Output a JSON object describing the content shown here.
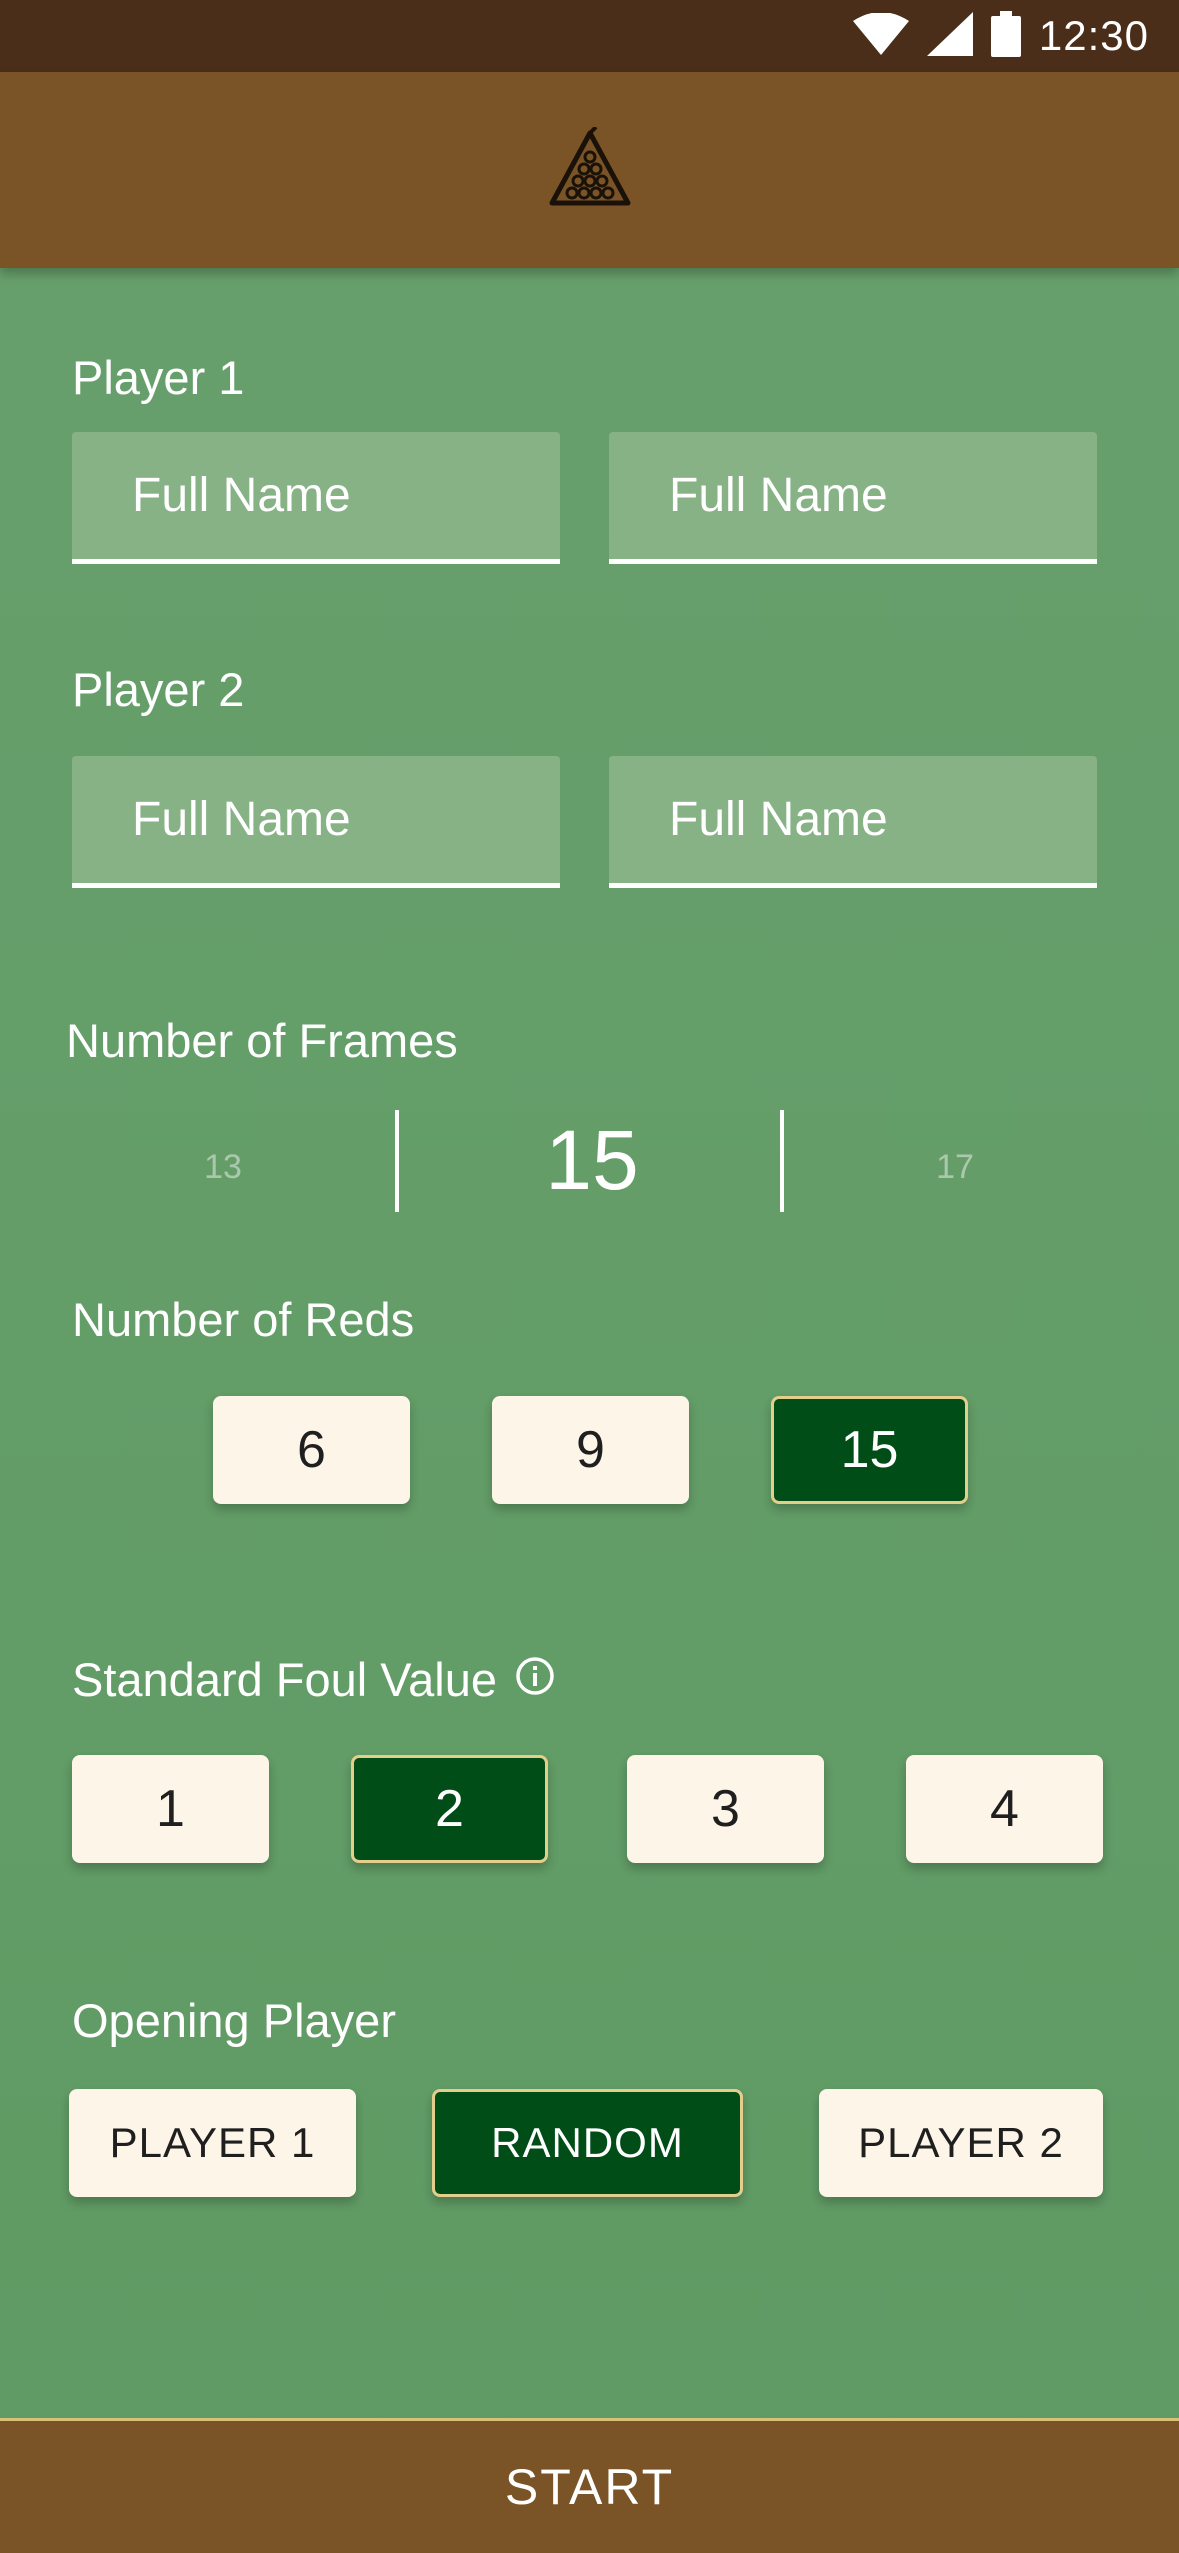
{
  "status_bar": {
    "time": "12:30"
  },
  "header": {
    "logo_icon": "billiard-rack-icon"
  },
  "player1": {
    "label": "Player 1",
    "first_name_placeholder": "Full Name",
    "last_name_placeholder": "Full Name"
  },
  "player2": {
    "label": "Player 2",
    "first_name_placeholder": "Full Name",
    "last_name_placeholder": "Full Name"
  },
  "frames": {
    "label": "Number of Frames",
    "prev": "13",
    "current": "15",
    "next": "17"
  },
  "reds": {
    "label": "Number of Reds",
    "options": [
      "6",
      "9",
      "15"
    ],
    "selected": "15"
  },
  "foul": {
    "label": "Standard Foul Value",
    "info_icon": "info-icon",
    "options": [
      "1",
      "2",
      "3",
      "4"
    ],
    "selected": "2"
  },
  "opening": {
    "label": "Opening Player",
    "options": [
      "PLAYER 1",
      "RANDOM",
      "PLAYER 2"
    ],
    "selected": "RANDOM"
  },
  "start_label": "START",
  "colors": {
    "background_green": "#649c68",
    "header_brown": "#7a5426",
    "status_brown": "#4a2e1a",
    "selected_green": "#004d18",
    "option_cream": "#fdf5e7",
    "selected_border": "#e3cf8b"
  }
}
